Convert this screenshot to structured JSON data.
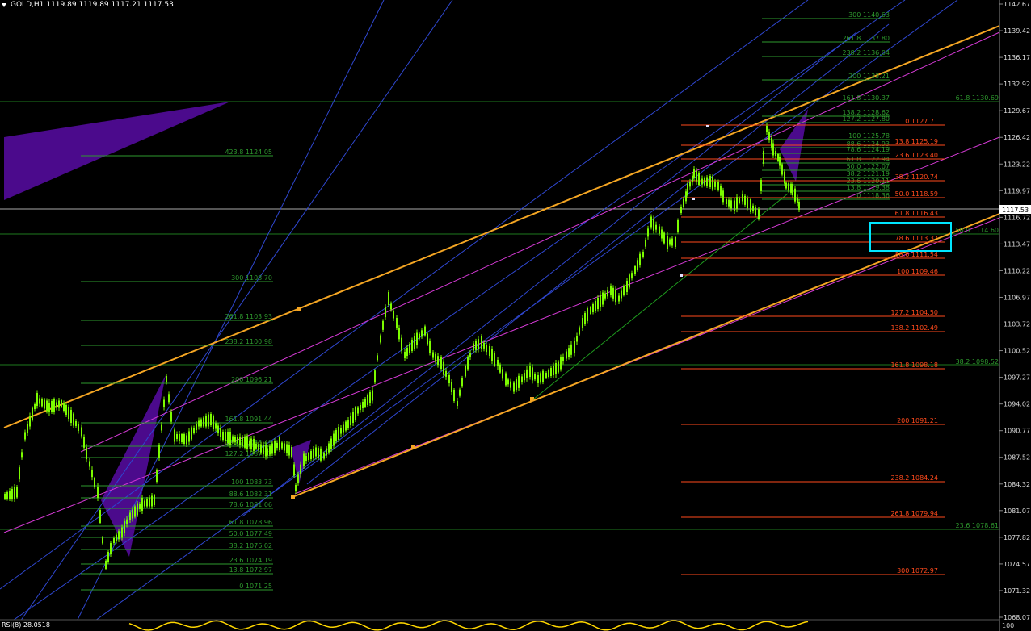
{
  "header": {
    "symbol_tf": "GOLD,H1",
    "quote": "1119.89 1119.89 1117.21 1117.53"
  },
  "rsi_label": "RSI(8) 28.0518",
  "price_axis": {
    "labels": [
      "1142.67",
      "1139.42",
      "1136.17",
      "1132.92",
      "1129.67",
      "1126.42",
      "1123.22",
      "1119.97",
      "1116.72",
      "1113.47",
      "1110.22",
      "1106.97",
      "1103.72",
      "1100.52",
      "1097.27",
      "1094.02",
      "1090.77",
      "1087.52",
      "1084.32",
      "1081.07",
      "1077.82",
      "1074.57",
      "1071.32",
      "1068.07"
    ],
    "current_price": "1117.53",
    "rsi_top": "100"
  },
  "fib_levels": {
    "green_left_upper": [
      {
        "text": "300 1108.70"
      },
      {
        "text": "261.8 1103.93"
      },
      {
        "text": "238.2 1100.98"
      },
      {
        "text": "200 1096.21"
      },
      {
        "text": "161.8 1091.44"
      },
      {
        "text": "138.2 1088.49"
      },
      {
        "text": "127.2 1087.12"
      }
    ],
    "green_left_lower": [
      {
        "text": "100 1083.73"
      },
      {
        "text": "88.6 1082.31"
      },
      {
        "text": "78.6 1081.06"
      },
      {
        "text": "61.8 1078.96"
      },
      {
        "text": "50.0 1077.49"
      },
      {
        "text": "38.2 1076.02"
      },
      {
        "text": "23.6 1074.19"
      },
      {
        "text": "13.8 1072.97"
      },
      {
        "text": "0 1071.25"
      }
    ],
    "overlap_left": {
      "text": "423.8 1124.05"
    },
    "green_right_top": [
      {
        "text": "300 1140.63"
      },
      {
        "text": "261.8 1137.80"
      },
      {
        "text": "238.2 1136.04"
      },
      {
        "text": "200 1133.21"
      },
      {
        "text": "161.8 1130.37"
      },
      {
        "text": "138.2 1128.62"
      },
      {
        "text": "127.2 1127.80"
      },
      {
        "text": "100 1125.78"
      },
      {
        "text": "88.6 1124.93"
      },
      {
        "text": "78.6 1124.19"
      },
      {
        "text": "61.8 1122.94"
      },
      {
        "text": "50.0 1122.07"
      },
      {
        "text": "38.2 1121.19"
      },
      {
        "text": "23.6 1120.11"
      },
      {
        "text": "13.8 1119.38"
      },
      {
        "text": "0 1118.36"
      }
    ],
    "red_right": [
      {
        "text": "0 1127.71"
      },
      {
        "text": "13.8 1125.19"
      },
      {
        "text": "23.6 1123.40"
      },
      {
        "text": "38.2 1120.74"
      },
      {
        "text": "50.0 1118.59"
      },
      {
        "text": "61.8 1116.43"
      },
      {
        "text": "78.6 1113.37"
      },
      {
        "text": "88.6 1111.54"
      },
      {
        "text": "100 1109.46"
      },
      {
        "text": "127.2 1104.50"
      },
      {
        "text": "138.2 1102.49"
      },
      {
        "text": "161.8 1098.18"
      },
      {
        "text": "200 1091.21"
      },
      {
        "text": "238.2 1084.24"
      },
      {
        "text": "261.8 1079.94"
      },
      {
        "text": "300 1072.97"
      }
    ],
    "far_right": [
      {
        "text": "61.8 1130.69"
      },
      {
        "text": "50.0 1114.60"
      },
      {
        "text": "38.2 1098.52"
      },
      {
        "text": "23.6 1078.61"
      }
    ]
  },
  "colors": {
    "background": "#000000",
    "candle": "#7cfc00",
    "fib_green": "#2e8b2e",
    "fib_red": "#ff4500",
    "channel": "#f5a623",
    "magenta": "#d63ad6",
    "blue_lines": "#3a4fd6",
    "purple_fill": "#5a0aa0",
    "highlight_box": "#00e5ff",
    "rsi_line": "#ffd700"
  }
}
